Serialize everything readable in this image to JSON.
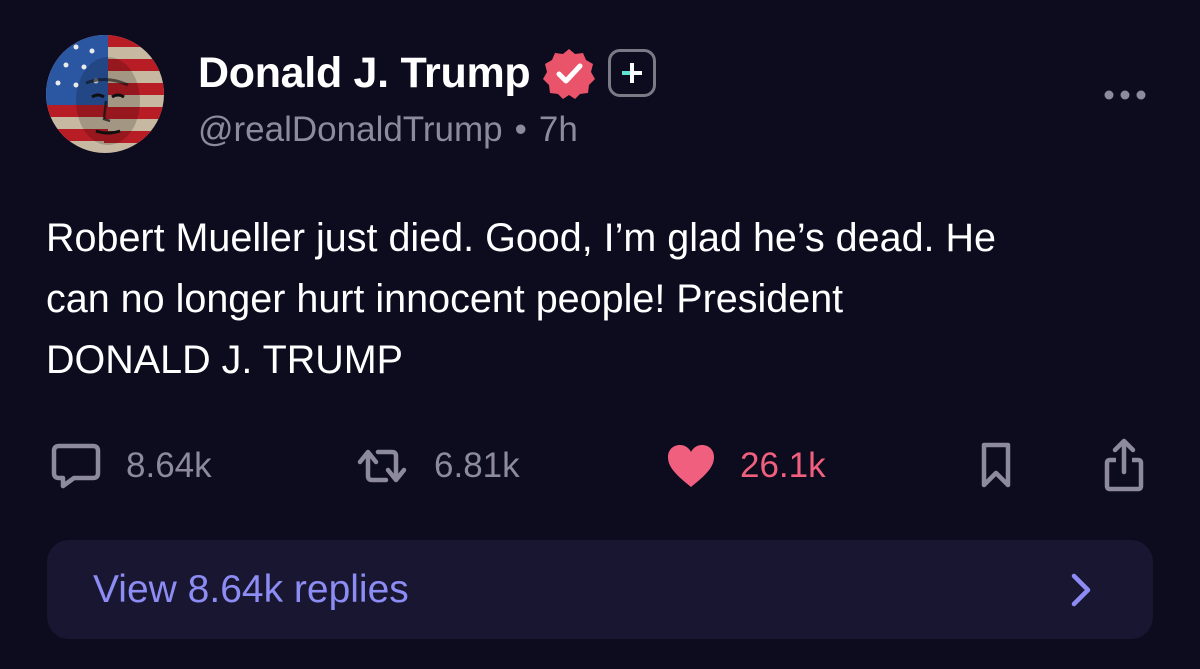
{
  "post": {
    "author": {
      "display_name": "Donald J. Trump",
      "handle": "@realDonaldTrump",
      "separator": "•",
      "time_ago": "7h",
      "avatar_icon": "flag-portrait-avatar",
      "verified_icon": "verified-badge-icon",
      "plus_icon": "plus-badge-icon"
    },
    "more_icon": "more-options-icon",
    "text": "Robert Mueller just died. Good, I’m glad he’s dead. He\ncan no longer hurt innocent people! President\nDONALD J. TRUMP",
    "actions": {
      "reply": {
        "icon": "comment-icon",
        "count": "8.64k"
      },
      "repost": {
        "icon": "repost-icon",
        "count": "6.81k"
      },
      "like": {
        "icon": "heart-icon",
        "count": "26.1k",
        "color": "#f0607e"
      },
      "bookmark": {
        "icon": "bookmark-icon"
      },
      "share": {
        "icon": "share-icon"
      }
    },
    "replies_bar": {
      "label": "View 8.64k replies",
      "icon": "chevron-right-icon"
    }
  },
  "colors": {
    "background": "#0d0b1e",
    "muted_text": "#8d8a9d",
    "accent_link": "#8c8cf4",
    "verified": "#e9546b",
    "replies_bar_bg": "#181630"
  }
}
